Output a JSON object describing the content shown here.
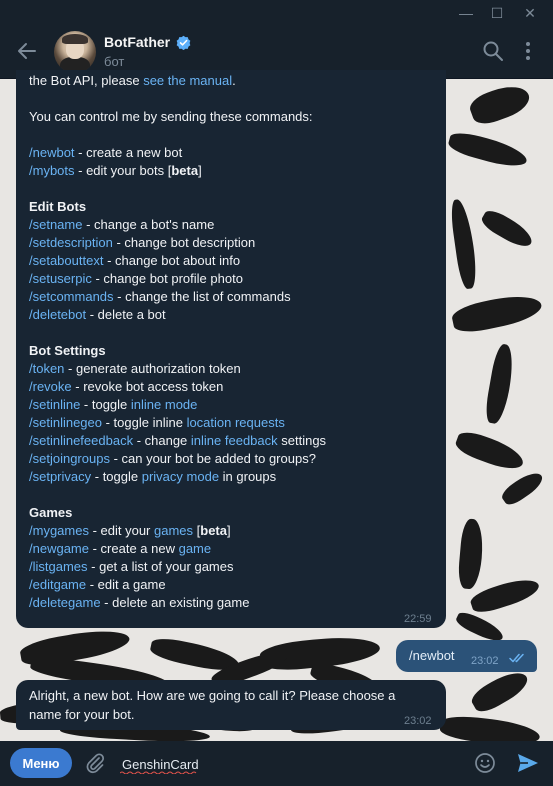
{
  "window": {
    "minimize_glyph": "—",
    "maximize_glyph": "☐",
    "close_glyph": "✕"
  },
  "header": {
    "title": "BotFather",
    "subtitle": "бот"
  },
  "messages": {
    "intro": {
      "line1_prefix": "the Bot API, please ",
      "line1_link": "see the manual",
      "line1_suffix": ".",
      "control": "You can control me by sending these commands:",
      "time": "22:59"
    },
    "basic": [
      {
        "cmd": "/newbot",
        "desc": " - create a new bot"
      },
      {
        "cmd": "/mybots",
        "desc": " - edit your bots [",
        "bold": "beta",
        "after": "]"
      }
    ],
    "edit_title": "Edit Bots",
    "edit": [
      {
        "cmd": "/setname",
        "desc": " - change a bot's name"
      },
      {
        "cmd": "/setdescription",
        "desc": " - change bot description"
      },
      {
        "cmd": "/setabouttext",
        "desc": " - change bot about info"
      },
      {
        "cmd": "/setuserpic",
        "desc": " - change bot profile photo"
      },
      {
        "cmd": "/setcommands",
        "desc": " - change the list of commands"
      },
      {
        "cmd": "/deletebot",
        "desc": " - delete a bot"
      }
    ],
    "settings_title": "Bot Settings",
    "settings": [
      {
        "cmd": "/token",
        "desc": " - generate authorization token"
      },
      {
        "cmd": "/revoke",
        "desc": " - revoke bot access token"
      },
      {
        "cmd": "/setinline",
        "desc": " - toggle ",
        "link": "inline mode"
      },
      {
        "cmd": "/setinlinegeo",
        "desc": " - toggle inline ",
        "link": "location requests"
      },
      {
        "cmd": "/setinlinefeedback",
        "desc": " - change ",
        "link": "inline feedback",
        "after": " settings"
      },
      {
        "cmd": "/setjoingroups",
        "desc": " - can your bot be added to groups?"
      },
      {
        "cmd": "/setprivacy",
        "desc": " - toggle ",
        "link": "privacy mode",
        "after": " in groups"
      }
    ],
    "games_title": "Games",
    "games": [
      {
        "cmd": "/mygames",
        "desc": " - edit your ",
        "link": "games",
        "after": " [",
        "bold": "beta",
        "after2": "]"
      },
      {
        "cmd": "/newgame",
        "desc": " - create a new ",
        "link": "game"
      },
      {
        "cmd": "/listgames",
        "desc": " - get a list of your games"
      },
      {
        "cmd": "/editgame",
        "desc": " - edit a game"
      },
      {
        "cmd": "/deletegame",
        "desc": " - delete an existing game"
      }
    ],
    "outgoing": {
      "text": "/newbot",
      "time": "23:02"
    },
    "reply": {
      "text": "Alright, a new bot. How are we going to call it? Please choose a name for your bot.",
      "time": "23:02"
    }
  },
  "composer": {
    "menu_label": "Меню",
    "input_value": "GenshinCard"
  },
  "colors": {
    "link": "#6ab3f3",
    "bubble_in": "#182533",
    "bubble_out": "#2b5278",
    "menu": "#3b7ad0"
  },
  "icons": [
    "back-arrow-icon",
    "verified-icon",
    "search-icon",
    "more-vert-icon",
    "paperclip-icon",
    "emoji-icon",
    "send-icon",
    "double-check-icon"
  ]
}
